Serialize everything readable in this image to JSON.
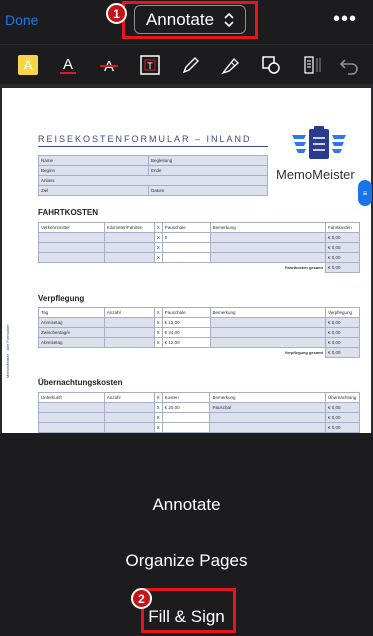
{
  "topbar": {
    "done_label": "Done",
    "mode_label": "Annotate",
    "more_label": "•••"
  },
  "toolbar": {
    "tools": [
      "highlight-tool-icon",
      "text-color-tool-icon",
      "strikethrough-tool-icon",
      "text-box-tool-icon",
      "pen-tool-icon",
      "marker-tool-icon",
      "shapes-tool-icon",
      "list-tool-icon",
      "undo-icon"
    ]
  },
  "callouts": {
    "first": "1",
    "second": "2"
  },
  "document": {
    "title": "REISEKOSTENFORMULAR – INLAND",
    "logo_text": "MemoMeister",
    "side_note": "MemoMeister · Alle Formulare",
    "info_rows": [
      {
        "label": "Name",
        "right": "Begleitung"
      },
      {
        "label": "Beginn",
        "right": "Ende"
      },
      {
        "label": "Anlass",
        "right": ""
      },
      {
        "label": "Ziel",
        "right": "Datum"
      }
    ],
    "fahrt": {
      "heading": "FAHRTKOSTEN",
      "headers": [
        "Verkehrsmittel",
        "Kilometer/Fahrten",
        "X",
        "Pauschale",
        "Bemerkung",
        "Fahrtkosten"
      ],
      "rows": [
        {
          "a": "",
          "b": "",
          "x": "X",
          "p": "0",
          "rem": "",
          "total": "€ 0,00"
        },
        {
          "a": "",
          "b": "",
          "x": "X",
          "p": "",
          "rem": "",
          "total": "€ 0,00"
        },
        {
          "a": "",
          "b": "",
          "x": "X",
          "p": "",
          "rem": "",
          "total": "€ 0,00"
        }
      ],
      "sum_label": "Fahrtkosten gesamt",
      "sum_value": "€ 0,00"
    },
    "verpflegung": {
      "heading": "Verpflegung",
      "headers": [
        "Tag",
        "Anzahl",
        "X",
        "Pauschale",
        "Bemerkung",
        "Verpflegung"
      ],
      "rows": [
        {
          "a": "Anreisetag",
          "b": "",
          "x": "X",
          "p": "€ 12,00",
          "rem": "",
          "total": "€ 0,00"
        },
        {
          "a": "Zwischentag/e",
          "b": "",
          "x": "X",
          "p": "€ 24,00",
          "rem": "",
          "total": "€ 0,00"
        },
        {
          "a": "Abreisetag",
          "b": "",
          "x": "X",
          "p": "€ 12,00",
          "rem": "",
          "total": "€ 0,00"
        }
      ],
      "sum_label": "Verpflegung gesamt",
      "sum_value": "€ 0,00"
    },
    "uebernachtung": {
      "heading": "Übernachtungskosten",
      "headers": [
        "Unterkunft",
        "Anzahl",
        "X",
        "Kosten",
        "Bemerkung",
        "Übernachtung"
      ],
      "rows": [
        {
          "a": "",
          "b": "",
          "x": "X",
          "p": "€ 20,00",
          "rem": "Pauschal",
          "total": "€ 0,00"
        },
        {
          "a": "",
          "b": "",
          "x": "X",
          "p": "",
          "rem": "",
          "total": "€ 0,00"
        },
        {
          "a": "",
          "b": "",
          "x": "X",
          "p": "",
          "rem": "",
          "total": "€ 0,00"
        }
      ]
    }
  },
  "menu": {
    "items": [
      "Annotate",
      "Organize Pages",
      "Fill & Sign"
    ]
  },
  "colors": {
    "accent": "#1877f2",
    "highlight_box": "#e4161b",
    "form_blue": "#3a4a8c"
  }
}
